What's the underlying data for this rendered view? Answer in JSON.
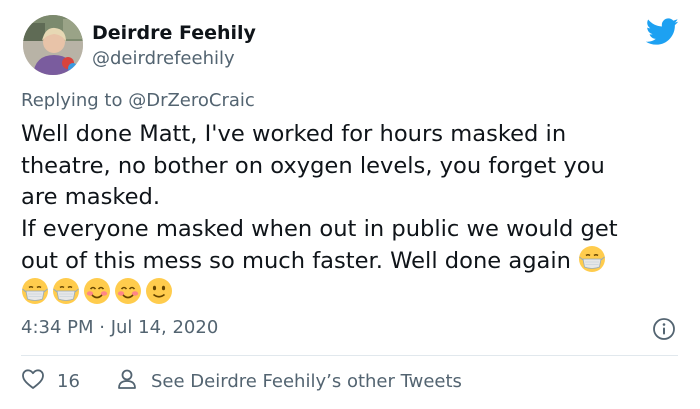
{
  "tweet": {
    "author_name": "Deirdre Feehily",
    "author_handle": "@deirdrefeehily",
    "replying_prefix": "Replying to ",
    "replying_mention": "@DrZeroCraic",
    "lines": [
      "Well done Matt, I've worked for hours masked in",
      "theatre,  no bother on oxygen levels,  you forget you",
      "are masked.",
      "If everyone masked when out in public we would get",
      "out of this mess so much faster.  Well done again"
    ],
    "emoji_row": [
      "mask-face",
      "mask-face",
      "smiling-blush-face",
      "smiling-blush-face",
      "slight-smile-face"
    ],
    "inline_emoji": "mask-face",
    "timestamp": "4:34 PM · Jul 14, 2020",
    "like_count": "16",
    "other_tweets_label": "See Deirdre Feehily’s other Tweets"
  },
  "colors": {
    "text": "#0f1419",
    "secondary": "#536471",
    "twitter_blue": "#1da1f2",
    "divider": "#e1e8ed"
  },
  "icons": {
    "brand": "twitter-bird-icon",
    "info": "info-icon",
    "like": "heart-icon",
    "profile": "person-icon"
  }
}
